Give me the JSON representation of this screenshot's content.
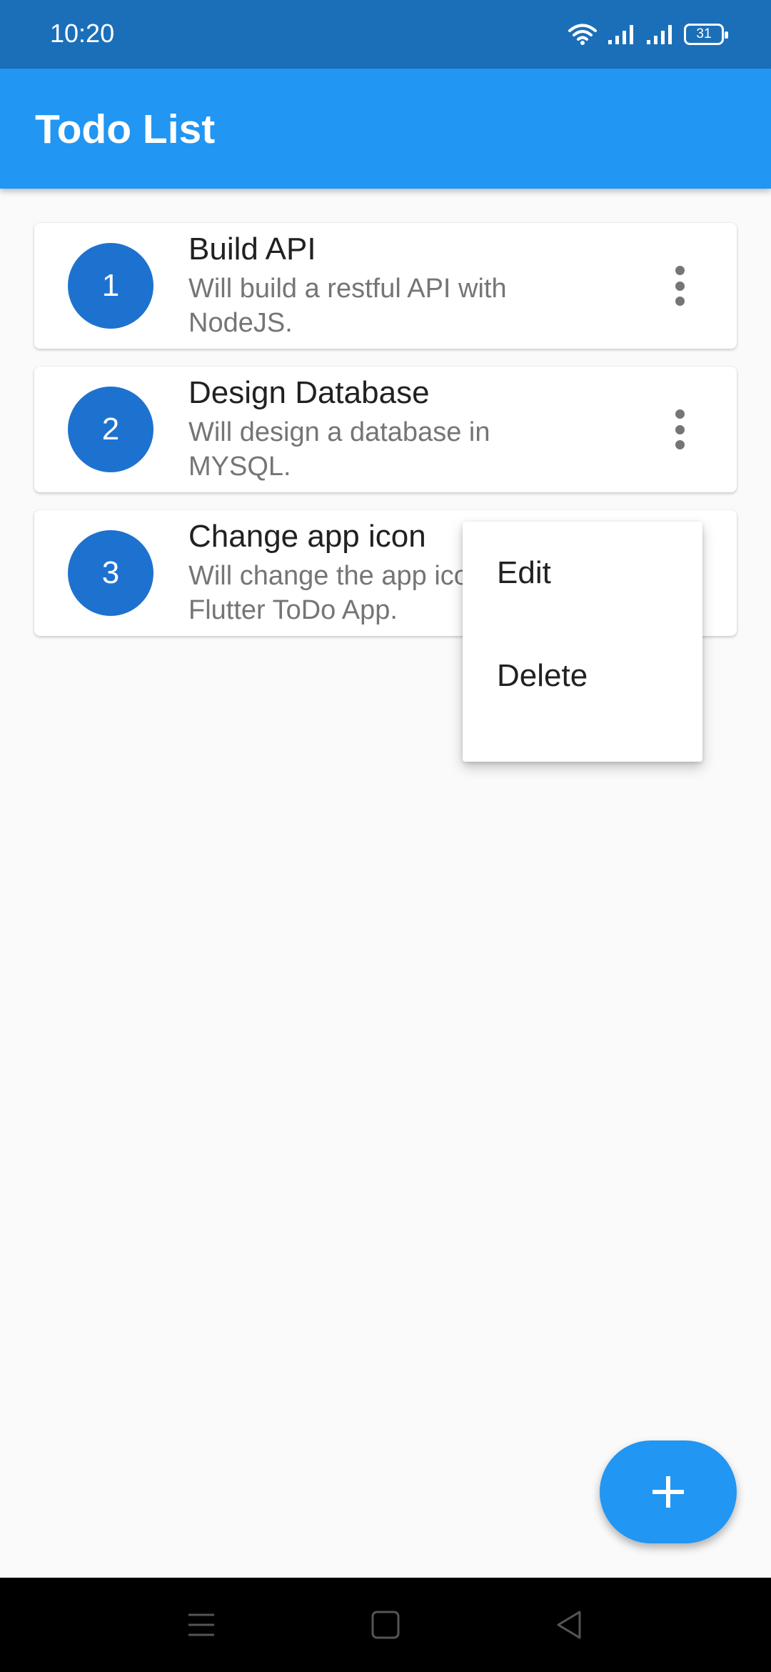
{
  "status_bar": {
    "time": "10:20",
    "battery": "31",
    "icons": [
      "wifi-icon",
      "signal-icon",
      "signal-icon",
      "battery-icon"
    ]
  },
  "app_bar": {
    "title": "Todo List"
  },
  "todos": [
    {
      "index": "1",
      "title": "Build API",
      "description": "Will build a restful API with NodeJS."
    },
    {
      "index": "2",
      "title": "Design Database",
      "description": "Will design a database in MYSQL."
    },
    {
      "index": "3",
      "title": "Change app icon",
      "description": "Will change the app icon of Flutter ToDo App."
    }
  ],
  "popup_menu": {
    "items": [
      {
        "label": "Edit"
      },
      {
        "label": "Delete"
      }
    ]
  },
  "fab": {
    "icon": "plus-icon"
  },
  "nav_bar": {
    "icons": [
      "menu-icon",
      "home-icon",
      "back-icon"
    ]
  },
  "colors": {
    "status_bar": "#1b6fb8",
    "primary": "#2196f3",
    "avatar": "#1e72cf",
    "background": "#fafafa"
  }
}
